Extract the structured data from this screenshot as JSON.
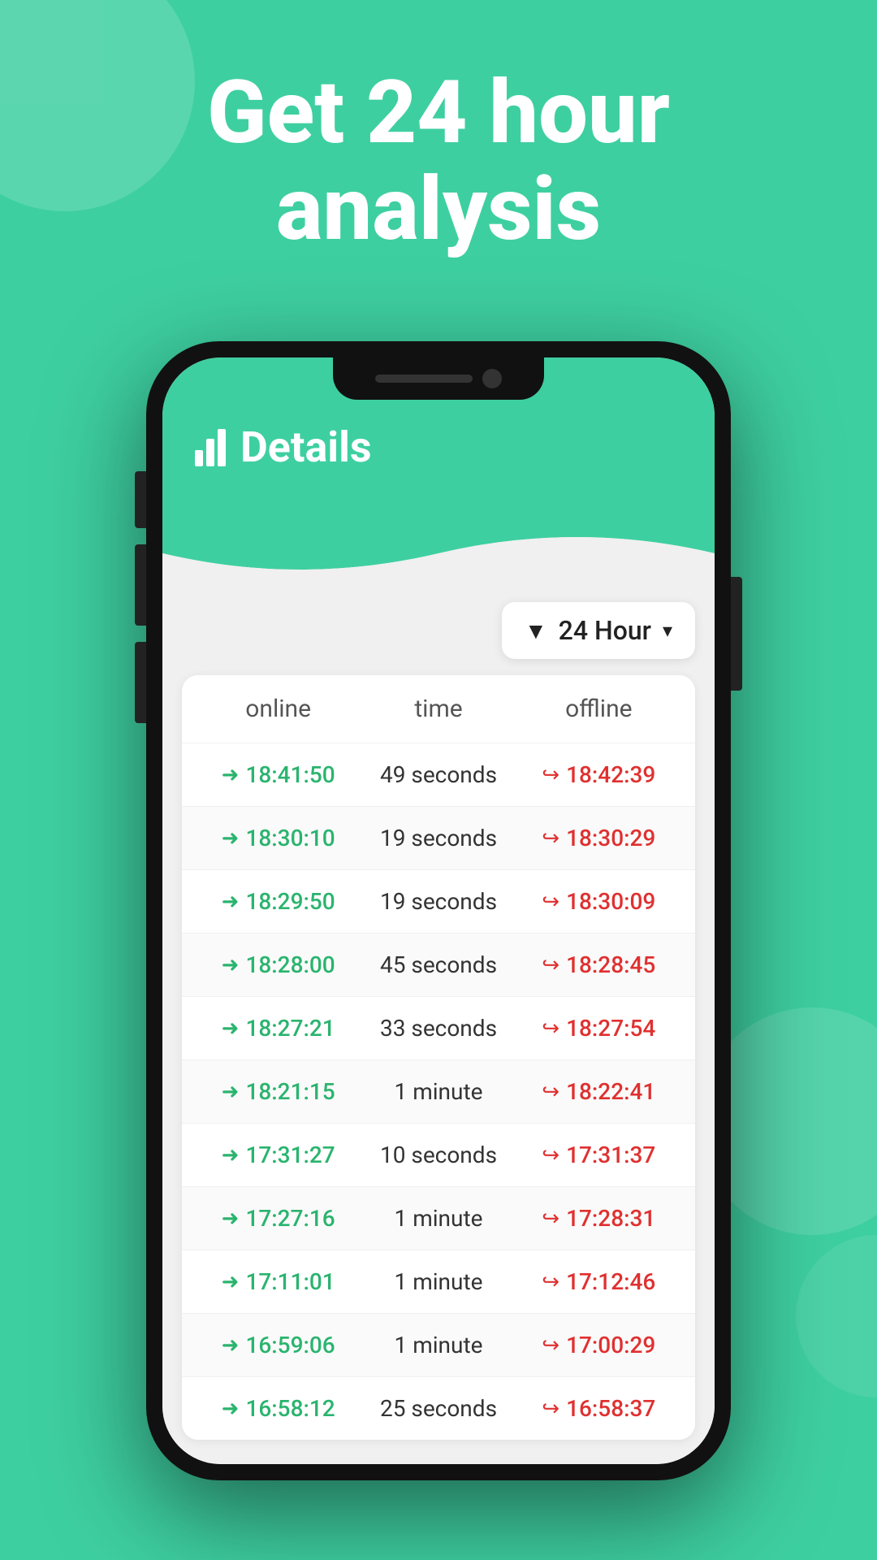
{
  "background": {
    "color": "#3ecfa0"
  },
  "hero": {
    "title_line1": "Get 24 hour",
    "title_line2": "analysis"
  },
  "phone": {
    "screen": {
      "header": {
        "icon_label": "bar-chart-icon",
        "title": "Details"
      },
      "filter": {
        "label": "24 Hour",
        "icon": "▼"
      },
      "table": {
        "headers": [
          "online",
          "time",
          "offline"
        ],
        "rows": [
          {
            "online": "18:41:50",
            "time": "49 seconds",
            "offline": "18:42:39"
          },
          {
            "online": "18:30:10",
            "time": "19 seconds",
            "offline": "18:30:29"
          },
          {
            "online": "18:29:50",
            "time": "19 seconds",
            "offline": "18:30:09"
          },
          {
            "online": "18:28:00",
            "time": "45 seconds",
            "offline": "18:28:45"
          },
          {
            "online": "18:27:21",
            "time": "33 seconds",
            "offline": "18:27:54"
          },
          {
            "online": "18:21:15",
            "time": "1 minute",
            "offline": "18:22:41"
          },
          {
            "online": "17:31:27",
            "time": "10 seconds",
            "offline": "17:31:37"
          },
          {
            "online": "17:27:16",
            "time": "1 minute",
            "offline": "17:28:31"
          },
          {
            "online": "17:11:01",
            "time": "1 minute",
            "offline": "17:12:46"
          },
          {
            "online": "16:59:06",
            "time": "1 minute",
            "offline": "17:00:29"
          },
          {
            "online": "16:58:12",
            "time": "25 seconds",
            "offline": "16:58:37"
          }
        ]
      }
    }
  }
}
